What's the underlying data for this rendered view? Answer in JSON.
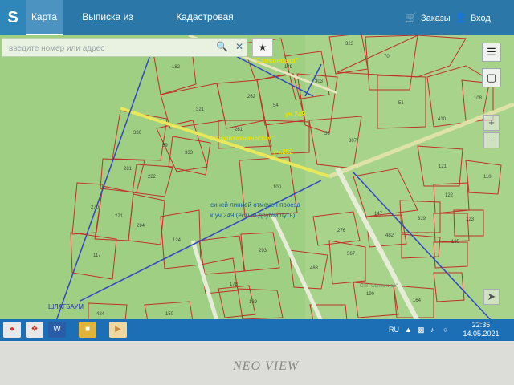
{
  "app": {
    "logo": "S",
    "tabs": [
      {
        "label": "Карта",
        "active": true
      },
      {
        "label": "Выписка из ЕГРН",
        "active": false
      },
      {
        "label": "Кадастровая стоимость",
        "active": false
      }
    ],
    "orders_label": "Заказы",
    "login_label": "Вход",
    "search_placeholder": "введите номер или адрес"
  },
  "map": {
    "streets": [
      "\"Самсоновка\"",
      "\"Политехническая\""
    ],
    "plots": [
      "182",
      "149",
      "303",
      "323",
      "70",
      "321",
      "262",
      "54",
      "51",
      "410",
      "108",
      "330",
      "261",
      "56",
      "307",
      "59",
      "333",
      "281",
      "282",
      "100",
      "121",
      "110",
      "270",
      "271",
      "294",
      "147",
      "319",
      "122",
      "123",
      "276",
      "482",
      "135",
      "124",
      "117",
      "293",
      "567",
      "483",
      "178",
      "189",
      "190",
      "164",
      "150",
      "424",
      "187"
    ],
    "annotations": [
      "уч.249",
      "уч.252",
      "синей линией отмечен проезд",
      "к уч.249 (есть и другой путь)"
    ],
    "barrier_label": "ШЛАГБАУМ",
    "snt_label": "Снт \"Солнечное\"",
    "colors": {
      "map_bg": "#9fcf82",
      "plot_border": "#c0312a",
      "topbar": "#2b78a8",
      "route": "#3347c4"
    }
  },
  "taskbar": {
    "lang": "RU",
    "time": "22:35",
    "date": "14.05.2021",
    "apps": [
      "chrome-icon",
      "pdf-icon",
      "word-icon",
      "folder-icon",
      "media-icon"
    ]
  },
  "monitor": {
    "brand": "NEO VIEW"
  }
}
